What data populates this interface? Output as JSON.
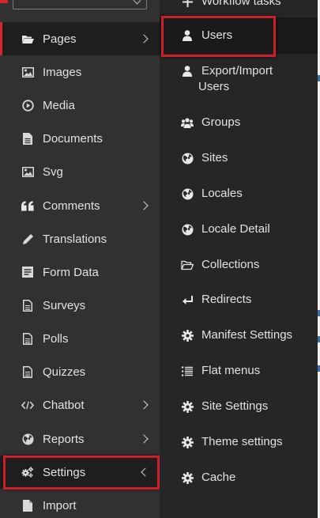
{
  "sidebar": {
    "items": [
      {
        "label": "Pages",
        "icon": "folder-open-icon",
        "has_arrow": "right",
        "active": true
      },
      {
        "label": "Images",
        "icon": "image-icon"
      },
      {
        "label": "Media",
        "icon": "play-circle-icon"
      },
      {
        "label": "Documents",
        "icon": "document-icon"
      },
      {
        "label": "Svg",
        "icon": "image-icon"
      },
      {
        "label": "Comments",
        "icon": "quote-icon",
        "has_arrow": "right"
      },
      {
        "label": "Translations",
        "icon": "pencil-icon"
      },
      {
        "label": "Form Data",
        "icon": "form-icon"
      },
      {
        "label": "Surveys",
        "icon": "list-document-icon"
      },
      {
        "label": "Polls",
        "icon": "list-document-icon"
      },
      {
        "label": "Quizzes",
        "icon": "list-document-icon"
      },
      {
        "label": "Chatbot",
        "icon": "code-icon",
        "has_arrow": "right"
      },
      {
        "label": "Reports",
        "icon": "globe-icon",
        "has_arrow": "right"
      },
      {
        "label": "Settings",
        "icon": "cogs-icon",
        "has_arrow": "left",
        "highlighted": true
      },
      {
        "label": "Import",
        "icon": "document-icon"
      }
    ]
  },
  "submenu": {
    "top_partial": "Workflow tasks",
    "items": [
      {
        "label": "Users",
        "icon": "user-icon",
        "active": true,
        "highlighted": true
      },
      {
        "label": "Export/Import",
        "label2": "Users",
        "icon": "user-icon"
      },
      {
        "label": "Groups",
        "icon": "group-icon"
      },
      {
        "label": "Sites",
        "icon": "globe-icon"
      },
      {
        "label": "Locales",
        "icon": "globe-icon"
      },
      {
        "label": "Locale Detail",
        "icon": "globe-icon"
      },
      {
        "label": "Collections",
        "icon": "folder-open-icon"
      },
      {
        "label": "Redirects",
        "icon": "redirect-arrow-icon"
      },
      {
        "label": "Manifest Settings",
        "icon": "gear-icon"
      },
      {
        "label": "Flat menus",
        "icon": "list-icon"
      },
      {
        "label": "Site Settings",
        "icon": "gear-icon"
      },
      {
        "label": "Theme settings",
        "icon": "gear-icon"
      },
      {
        "label": "Cache",
        "icon": "gear-icon"
      }
    ]
  },
  "colors": {
    "highlight": "#c9202a",
    "sidebar_bg": "#313131",
    "submenu_bg": "#262626",
    "text": "#e2e2e2"
  }
}
